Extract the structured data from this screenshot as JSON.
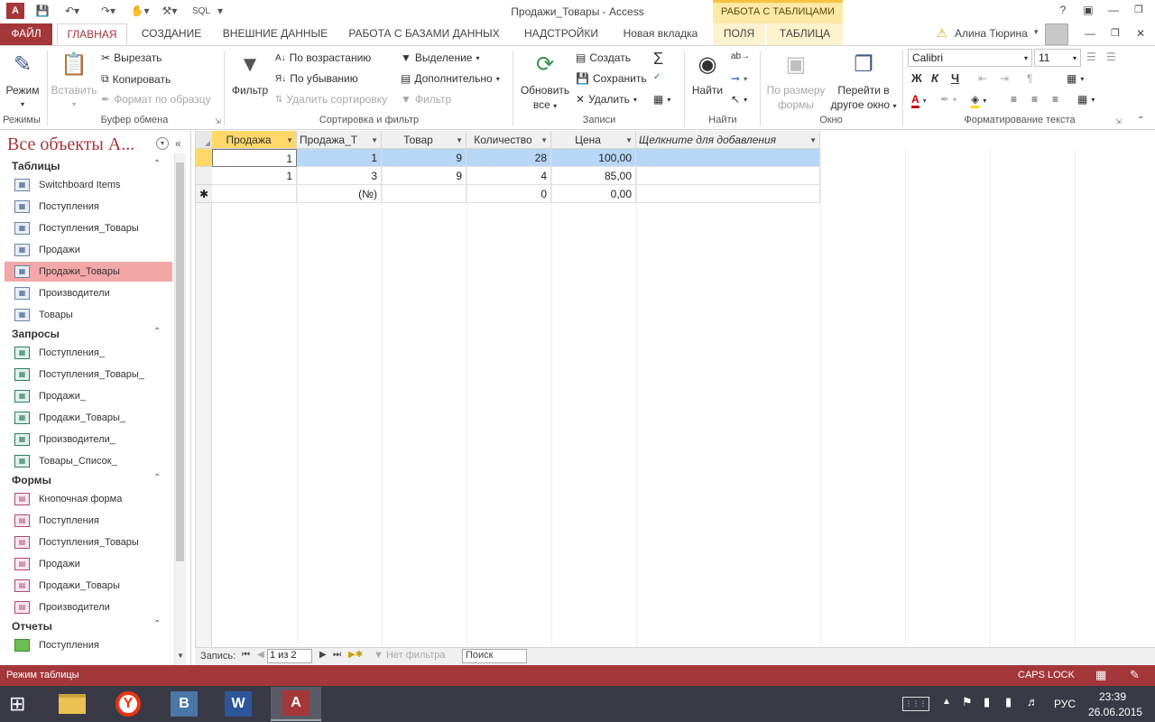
{
  "window": {
    "title": "Продажи_Товары - Access",
    "logo": "A",
    "context_header": "РАБОТА С ТАБЛИЦАМИ",
    "qat_sql": "SQL"
  },
  "tabs": [
    "ФАЙЛ",
    "ГЛАВНАЯ",
    "СОЗДАНИЕ",
    "ВНЕШНИЕ ДАННЫЕ",
    "РАБОТА С БАЗАМИ ДАННЫХ",
    "НАДСТРОЙКИ",
    "Новая вкладка",
    "ПОЛЯ",
    "ТАБЛИЦА"
  ],
  "user": {
    "name": "Алина Тюрина"
  },
  "ribbon": {
    "views": {
      "mode": "Режим",
      "group": "Режимы"
    },
    "clipboard": {
      "paste": "Вставить",
      "cut": "Вырезать",
      "copy": "Копировать",
      "format_painter": "Формат по образцу",
      "group": "Буфер обмена"
    },
    "sort_filter": {
      "filter": "Фильтр",
      "asc": "По возрастанию",
      "desc": "По убыванию",
      "remove_sort": "Удалить сортировку",
      "selection": "Выделение",
      "advanced": "Дополнительно",
      "toggle_filter": "Фильтр",
      "group": "Сортировка и фильтр"
    },
    "records": {
      "refresh_line1": "Обновить",
      "refresh_line2": "все",
      "new": "Создать",
      "save": "Сохранить",
      "delete": "Удалить",
      "group": "Записи"
    },
    "find": {
      "find": "Найти",
      "group": "Найти"
    },
    "window": {
      "fit_line1": "По размеру",
      "fit_line2": "формы",
      "switch_line1": "Перейти в",
      "switch_line2": "другое окно",
      "group": "Окно"
    },
    "text_format": {
      "font": "Calibri",
      "size": "11",
      "bold": "Ж",
      "italic": "К",
      "underline": "Ч",
      "group": "Форматирование текста"
    }
  },
  "nav": {
    "title": "Все объекты А...",
    "categories": {
      "tables": {
        "label": "Таблицы",
        "items": [
          "Switchboard Items",
          "Поступления",
          "Поступления_Товары",
          "Продажи",
          "Продажи_Товары",
          "Производители",
          "Товары"
        ]
      },
      "queries": {
        "label": "Запросы",
        "items": [
          "Поступления_",
          "Поступления_Товары_",
          "Продажи_",
          "Продажи_Товары_",
          "Производители_",
          "Товары_Список_"
        ]
      },
      "forms": {
        "label": "Формы",
        "items": [
          "Кнопочная форма",
          "Поступления",
          "Поступления_Товары",
          "Продажи",
          "Продажи_Товары",
          "Производители"
        ]
      },
      "reports": {
        "label": "Отчеты",
        "items": [
          "Поступления"
        ]
      }
    }
  },
  "sheet": {
    "columns": [
      "Продажа",
      "Продажа_Т",
      "Товар",
      "Количество",
      "Цена",
      "Щелкните для добавления"
    ],
    "rows": [
      [
        "1",
        "1",
        "9",
        "28",
        "100,00"
      ],
      [
        "1",
        "3",
        "9",
        "4",
        "85,00"
      ],
      [
        "",
        "(№)",
        "",
        "0",
        "0,00"
      ]
    ]
  },
  "record_nav": {
    "label": "Запись:",
    "position": "1 из 2",
    "filter": "Нет фильтра",
    "search": "Поиск"
  },
  "status": {
    "mode": "Режим таблицы",
    "caps": "CAPS LOCK"
  },
  "taskbar": {
    "lang": "РУС",
    "time": "23:39",
    "date": "26.06.2015"
  },
  "colors": {
    "accent": "#a4373a",
    "context": "#fde9a5",
    "selected_row": "#b8d6f6",
    "nav_selected": "#f4a7a7"
  }
}
